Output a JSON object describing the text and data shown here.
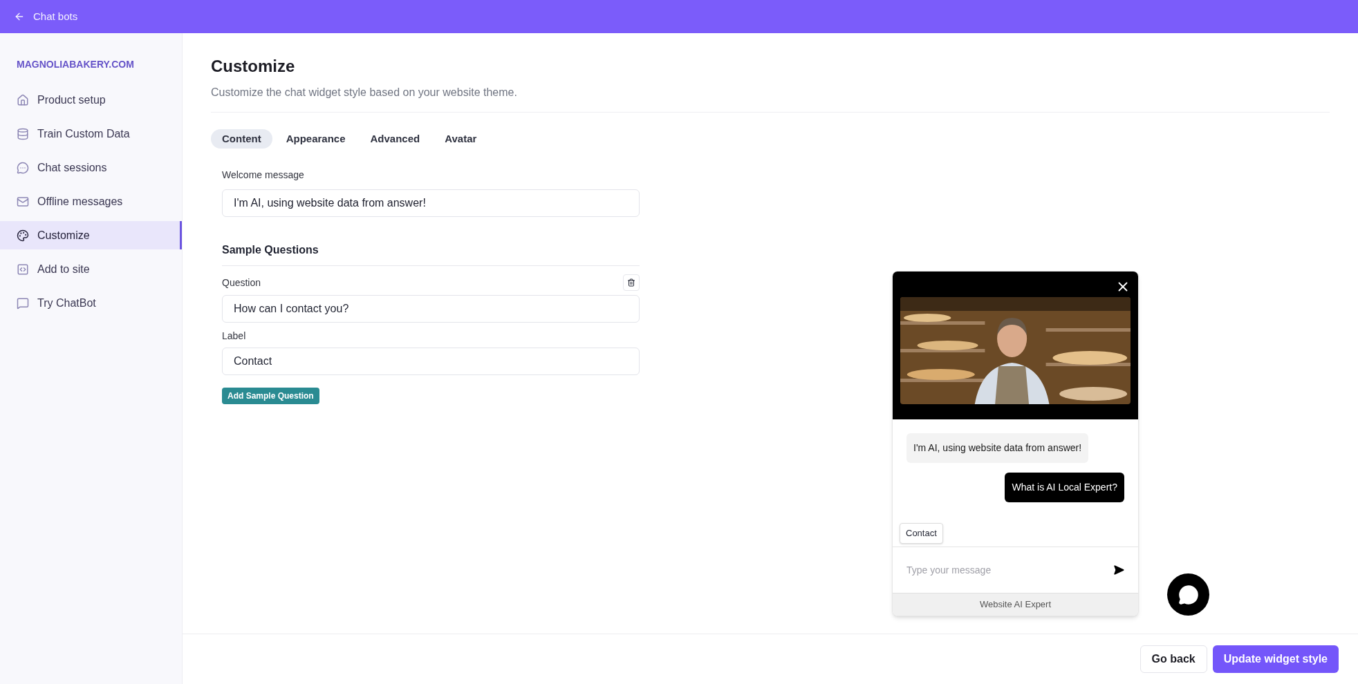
{
  "header": {
    "back_label": "Chat bots"
  },
  "sidebar": {
    "site": "MAGNOLIABAKERY.COM",
    "items": [
      {
        "label": "Product setup",
        "selected": false
      },
      {
        "label": "Train Custom Data",
        "selected": false
      },
      {
        "label": "Chat sessions",
        "selected": false
      },
      {
        "label": "Offline messages",
        "selected": false
      },
      {
        "label": "Customize",
        "selected": true
      },
      {
        "label": "Add to site",
        "selected": false
      },
      {
        "label": "Try ChatBot",
        "selected": false
      }
    ]
  },
  "page": {
    "title": "Customize",
    "subtitle": "Customize the chat widget style based on your website theme.",
    "tabs": [
      {
        "label": "Content",
        "selected": true
      },
      {
        "label": "Appearance",
        "selected": false
      },
      {
        "label": "Advanced",
        "selected": false
      },
      {
        "label": "Avatar",
        "selected": false
      }
    ],
    "welcome": {
      "label": "Welcome message",
      "value": "I'm AI, using website data from answer!"
    },
    "section_title": "Sample Questions",
    "questions": [
      {
        "question_label": "Question",
        "question_value": "How can I contact you?",
        "label_label": "Label",
        "label_value": "Contact"
      }
    ],
    "add_button": "Add Sample Question"
  },
  "widget": {
    "messages": [
      {
        "kind": "bot",
        "text": "I'm AI, using website data from answer!"
      },
      {
        "kind": "user",
        "text": "What is AI Local Expert?"
      }
    ],
    "quick_replies": [
      "Contact"
    ],
    "input_placeholder": "Type your message",
    "footer": "Website AI Expert"
  },
  "actions": [
    {
      "label": "Go back",
      "kind": "secondary"
    },
    {
      "label": "Update widget style",
      "kind": "primary"
    }
  ]
}
